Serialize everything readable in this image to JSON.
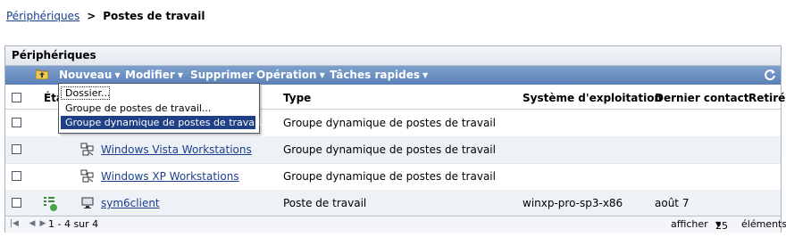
{
  "breadcrumb": {
    "link": "Périphériques",
    "separator": ">",
    "current": "Postes de travail"
  },
  "panel": {
    "title": "Périphériques"
  },
  "toolbar": {
    "items": [
      {
        "label": "Nouveau"
      },
      {
        "label": "Modifier"
      },
      {
        "label": "Supprimer"
      },
      {
        "label": "Opération"
      },
      {
        "label": "Tâches rapides"
      }
    ],
    "refresh_icon": "refresh-icon",
    "folder_icon": "folder-up-icon"
  },
  "dropdown": {
    "items": [
      {
        "label": "Dossier..."
      },
      {
        "label": "Groupe de postes de travail..."
      },
      {
        "label": "Groupe dynamique de postes de travail..."
      }
    ]
  },
  "table": {
    "headers": {
      "status": "État",
      "type": "Type",
      "os": "Système d'exploitation",
      "last_contact": "Dernier contact",
      "retired": "Retiré"
    },
    "rows": [
      {
        "name": "",
        "type": "Groupe dynamique de postes de travail",
        "os": "",
        "last_contact": "",
        "icon": "dynamic-group-icon"
      },
      {
        "name": "Windows Vista Workstations",
        "type": "Groupe dynamique de postes de travail",
        "os": "",
        "last_contact": "",
        "icon": "dynamic-group-icon"
      },
      {
        "name": "Windows XP Workstations",
        "type": "Groupe dynamique de postes de travail",
        "os": "",
        "last_contact": "",
        "icon": "dynamic-group-icon"
      },
      {
        "name": "sym6client",
        "type": "Poste de travail",
        "os": "winxp-pro-sp3-x86",
        "last_contact": "août 7",
        "icon": "workstation-icon",
        "status_icon": "status-ok-icon"
      }
    ]
  },
  "footer": {
    "range": "1 - 4 sur 4",
    "show_label": "afficher",
    "page_size": "25",
    "items_label": "éléments"
  },
  "colors": {
    "toolbar_bg": "#6a8fc3",
    "link": "#1a3f8f",
    "selected_menu": "#1f3f86"
  }
}
